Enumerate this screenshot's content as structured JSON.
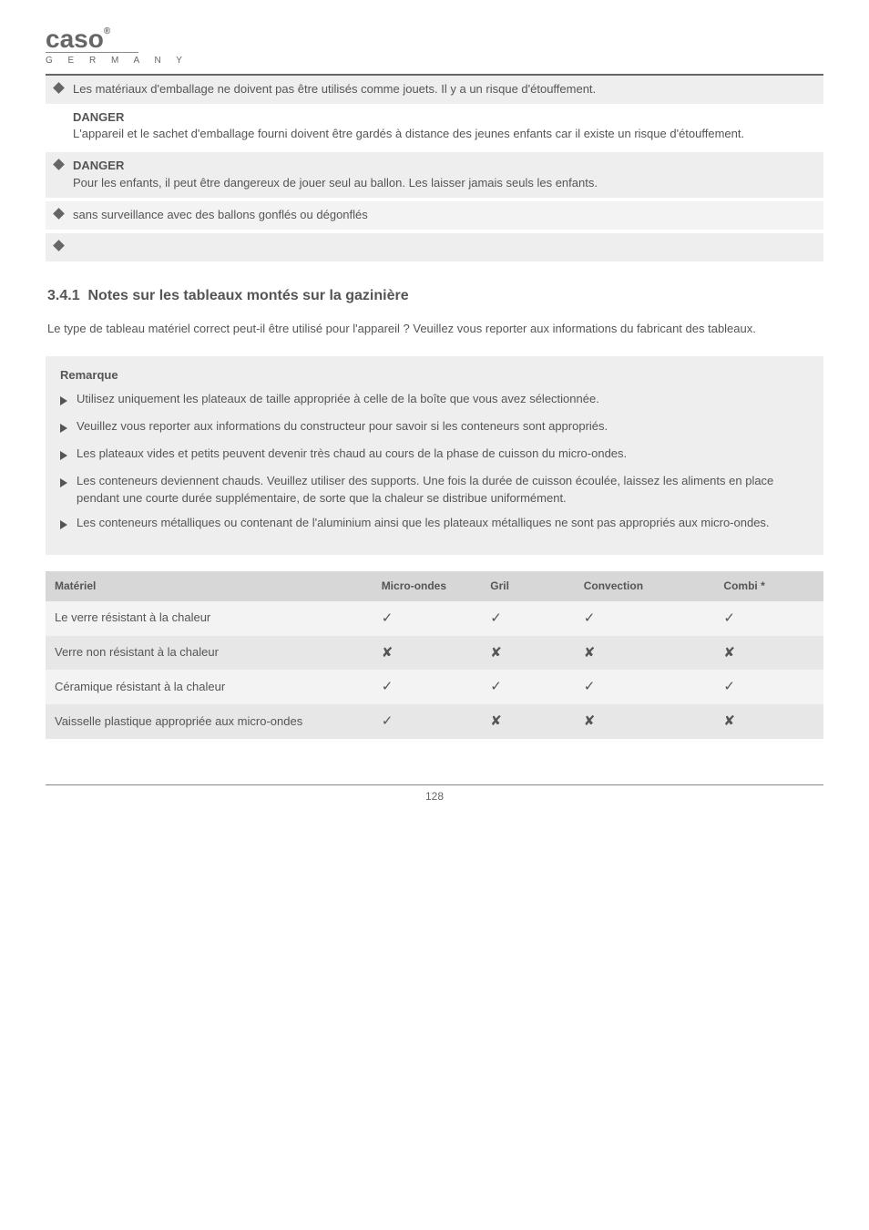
{
  "logo": {
    "brand_line1": "caso",
    "brand_reg": "®",
    "brand_line2": "G E R M A N Y"
  },
  "b1": "Les matériaux d'emballage ne doivent pas être utilisés comme jouets. Il y a un risque d'étouffement.",
  "b2_title": "DANGER",
  "b2_body": "L'appareil et le sachet d'emballage fourni doivent être gardés à distance des jeunes enfants car il existe un risque d'étouffement.",
  "b3_title": "DANGER",
  "b3_body": "Pour les enfants, il peut être dangereux de jouer seul au ballon. Les laisser jamais seuls les enfants.",
  "b4": "sans surveillance avec des ballons gonflés ou dégonflés",
  "section_no": "3.4.1",
  "section_title": "Notes sur les tableaux montés sur la gazinière",
  "section_intro": "Le type de tableau matériel correct peut-il être utilisé pour l'appareil ? Veuillez vous reporter aux informations du fabricant des tableaux.",
  "advice_header": "Remarque",
  "adv": [
    "Utilisez uniquement les plateaux de taille appropriée à celle de la boîte que vous avez sélectionnée.",
    "Veuillez vous reporter aux informations du constructeur pour savoir si les conteneurs sont appropriés.",
    "Les plateaux vides et petits peuvent devenir très chaud au cours de la phase de cuisson du micro-ondes.",
    "Les conteneurs deviennent chauds. Veuillez utiliser des supports. Une fois la durée de cuisson écoulée, laissez les aliments en place pendant une courte durée supplémentaire, de sorte que la chaleur se distribue uniformément.",
    "Les conteneurs métalliques ou contenant de l'aluminium ainsi que les plateaux métalliques ne sont pas appropriés aux micro-ondes."
  ],
  "cols": [
    "Matériel",
    "Micro-ondes",
    "Gril",
    "Convection",
    "Combi *"
  ],
  "rows": [
    {
      "name": "Le verre résistant à la chaleur",
      "c": [
        "ok",
        "ok",
        "ok",
        "ok"
      ]
    },
    {
      "name": "Verre non résistant à la chaleur",
      "c": [
        "no",
        "no",
        "no",
        "no"
      ]
    },
    {
      "name": "Céramique résistant à la chaleur",
      "c": [
        "ok",
        "ok",
        "ok",
        "ok"
      ]
    },
    {
      "name": "Vaisselle plastique appropriée aux micro-ondes",
      "c": [
        "ok",
        "no",
        "no",
        "no"
      ]
    }
  ],
  "page_number": "128"
}
